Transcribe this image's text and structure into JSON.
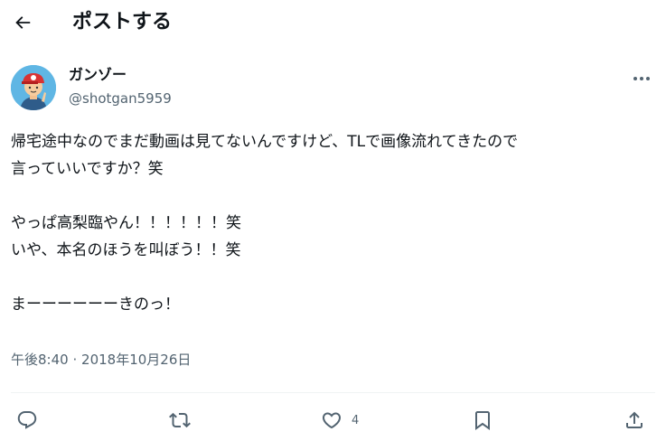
{
  "header": {
    "title": "ポストする"
  },
  "author": {
    "display_name": "ガンゾー",
    "handle": "@shotgan5959"
  },
  "post": {
    "lines": [
      "帰宅途中なのでまだ動画は見てないんですけど、TLで画像流れてきたので",
      "言っていいですか？笑",
      "",
      "やっぱ高梨臨やん！！！！！！笑",
      "いや、本名のほうを叫ぼう！！笑",
      "",
      "まーーーーーーきのっ！"
    ],
    "time": "午後8:40",
    "separator": "·",
    "date": "2018年10月26日"
  },
  "actions": {
    "reply_count": "",
    "repost_count": "",
    "like_count": "4",
    "bookmark_count": ""
  },
  "icons": {
    "back": "arrow-left-icon",
    "more": "more-dots-icon",
    "reply": "reply-icon",
    "repost": "repost-icon",
    "like": "heart-icon",
    "bookmark": "bookmark-icon",
    "share": "share-icon"
  },
  "colors": {
    "text": "#0f1419",
    "secondary": "#536471",
    "divider": "#eff3f4",
    "avatar_bg": "#5fb6e4"
  }
}
